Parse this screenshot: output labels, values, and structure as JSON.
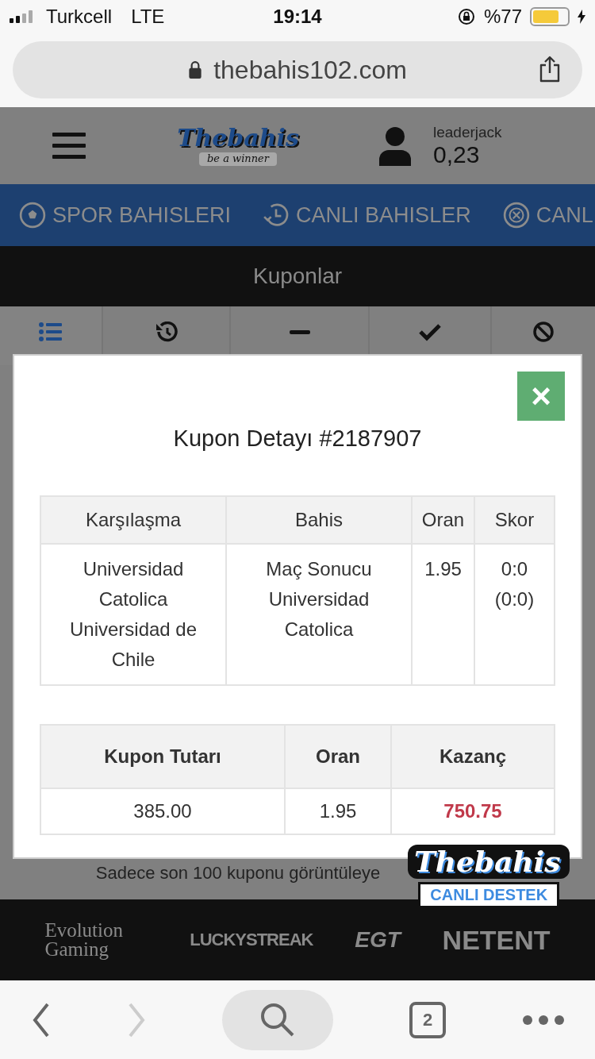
{
  "status_bar": {
    "carrier": "Turkcell",
    "network": "LTE",
    "time": "19:14",
    "battery_text": "%77",
    "battery": {
      "level": 0.77
    }
  },
  "url_bar": {
    "url": "thebahis102.com"
  },
  "header": {
    "logo": "Thebahis",
    "logo_tagline": "be a winner",
    "username": "leaderjack",
    "balance": "0,23"
  },
  "nav": [
    {
      "kind": "ball",
      "label": "SPOR BAHISLERI"
    },
    {
      "kind": "clock",
      "label": "CANLI BAHISLER"
    },
    {
      "kind": "roulette",
      "label": "CANL"
    }
  ],
  "page_title": "Kuponlar",
  "tabs": [
    {
      "kind": "list",
      "selected": true
    },
    {
      "kind": "history",
      "selected": false
    },
    {
      "kind": "minus",
      "selected": false
    },
    {
      "kind": "check",
      "selected": false
    },
    {
      "kind": "ban",
      "selected": false
    }
  ],
  "note": "Sadece son 100 kuponu görüntüleye",
  "modal": {
    "close": "×",
    "title": "Kupon Detayı #2187907",
    "matches": {
      "columns": [
        "Karşılaşma",
        "Bahis",
        "Oran",
        "Skor"
      ],
      "rows": [
        [
          "Universidad Catolica Universidad de Chile",
          "Maç Sonucu Universidad Catolica",
          "1.95",
          "0:0 (0:0)"
        ]
      ]
    },
    "summary": {
      "columns": [
        "Kupon Tutarı",
        "Oran",
        "Kazanç"
      ],
      "rows": [
        [
          "385.00",
          "1.95",
          "750.75"
        ]
      ]
    }
  },
  "support_badge": {
    "logo": "Thebahis",
    "label": "CANLI DESTEK"
  },
  "providers": [
    "Evolution Gaming",
    "LUCKYSTREAK",
    "EGT",
    "NETENT"
  ],
  "toolbar": {
    "tabs_count": "2"
  }
}
